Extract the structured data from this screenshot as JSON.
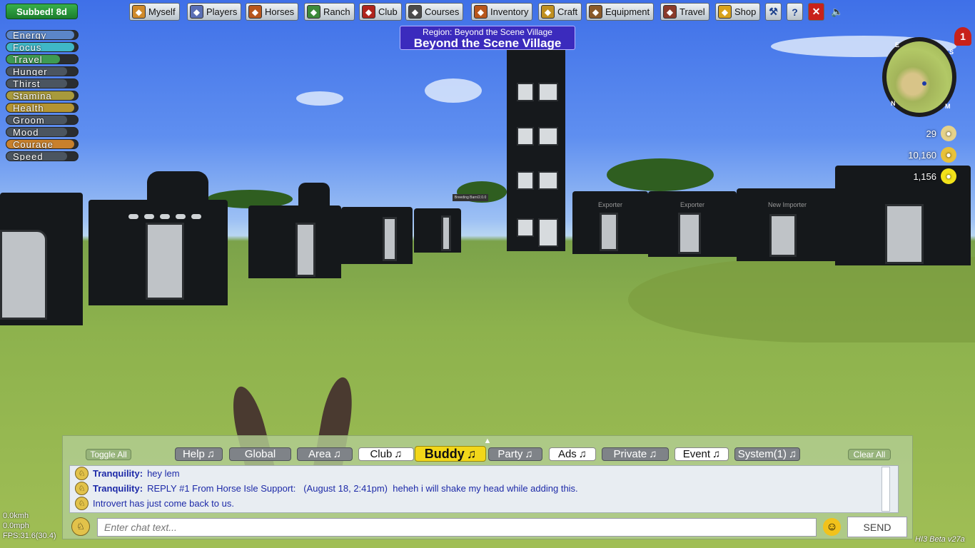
{
  "subbed": "Subbed! 8d",
  "top_menu": [
    {
      "label": "Myself",
      "icon": "person-icon",
      "color": "#d08a2a"
    },
    {
      "label": "Players",
      "icon": "players-icon",
      "color": "#5a6fb5"
    },
    {
      "label": "Horses",
      "icon": "horse-icon",
      "color": "#b8561b"
    },
    {
      "label": "Ranch",
      "icon": "fence-icon",
      "color": "#3d8a3a"
    },
    {
      "label": "Club",
      "icon": "club-icon",
      "color": "#b0241d"
    },
    {
      "label": "Courses",
      "icon": "grid-icon",
      "color": "#4b4b4b"
    },
    {
      "label": "Inventory",
      "icon": "bag-icon",
      "color": "#b8561b"
    },
    {
      "label": "Craft",
      "icon": "bowl-icon",
      "color": "#c09020"
    },
    {
      "label": "Equipment",
      "icon": "saddle-icon",
      "color": "#8a5a2a"
    },
    {
      "label": "Travel",
      "icon": "cart-icon",
      "color": "#8a3a2a"
    },
    {
      "label": "Shop",
      "icon": "coin-icon",
      "color": "#d8a21a"
    }
  ],
  "tools": {
    "wrench": "wrench-icon",
    "help": "?",
    "close": "✕",
    "sound": "speaker-icon"
  },
  "stats": [
    {
      "label": "Energy",
      "level": 0.95,
      "color": "#5b86c8"
    },
    {
      "label": "Focus",
      "level": 0.95,
      "color": "#3fb7c7"
    },
    {
      "label": "Travel",
      "level": 0.75,
      "color": "#3e9b52"
    },
    {
      "label": "Hunger",
      "level": 0.85,
      "color": "#4b5560"
    },
    {
      "label": "Thirst",
      "level": 0.85,
      "color": "#4b5560"
    },
    {
      "label": "Stamina",
      "level": 0.95,
      "color": "#a89a3c"
    },
    {
      "label": "Health",
      "level": 0.95,
      "color": "#b49432"
    },
    {
      "label": "Groom",
      "level": 0.85,
      "color": "#4b5560"
    },
    {
      "label": "Mood",
      "level": 0.85,
      "color": "#4b5560"
    },
    {
      "label": "Courage",
      "level": 0.95,
      "color": "#c8802c"
    },
    {
      "label": "Speed",
      "level": 0.85,
      "color": "#4b5560"
    }
  ],
  "region": {
    "subtitle": "Region: Beyond the Scene Village",
    "title": "Beyond the Scene Village"
  },
  "notification_count": "1",
  "minimap": {
    "n": "N",
    "e": "E",
    "s": "S",
    "m": "M"
  },
  "currency": [
    {
      "value": "29",
      "icon": "glasses-icon",
      "color": "#e5d28a"
    },
    {
      "value": "10,160",
      "icon": "money-icon",
      "color": "#e8c23a"
    },
    {
      "value": "1,156",
      "icon": "sun-icon",
      "color": "#f2e21a"
    }
  ],
  "scene_labels": {
    "exporter_1": "Exporter",
    "exporter_2": "Exporter",
    "importer": "New Importer",
    "sign": "Breeding Barn/2.0.0"
  },
  "chat": {
    "toggle_all": "Toggle All",
    "clear_all": "Clear All",
    "tabs": [
      {
        "label": "Help",
        "style": "gray",
        "note": "♫"
      },
      {
        "label": "Global",
        "style": "gray",
        "note": ""
      },
      {
        "label": "Area",
        "style": "gray",
        "note": "♫"
      },
      {
        "label": "Club",
        "style": "white",
        "note": "♫"
      },
      {
        "label": "Buddy",
        "style": "yellow",
        "note": "♫"
      },
      {
        "label": "Party",
        "style": "gray",
        "note": "♫"
      },
      {
        "label": "Ads",
        "style": "white",
        "note": "♫"
      },
      {
        "label": "Private",
        "style": "gray",
        "note": "♫"
      },
      {
        "label": "Event",
        "style": "white",
        "note": "♫"
      },
      {
        "label": "System(1)",
        "style": "gray",
        "note": "♫"
      }
    ],
    "messages": [
      {
        "name": "Tranquility:",
        "text": "hey lem"
      },
      {
        "name": "Tranquility:",
        "text": "REPLY #1 From Horse Isle Support:   (August 18, 2:41pm)  heheh i will shake my head while adding this."
      },
      {
        "name": "",
        "text": "Introvert has just come back to us."
      }
    ],
    "input_placeholder": "Enter chat text...",
    "send_label": "SEND"
  },
  "speed_readout": {
    "kmh": "0.0kmh",
    "mph": "0.0mph",
    "fps": "FPS:31.6(30.4)"
  },
  "version": "HI3 Beta v27a"
}
